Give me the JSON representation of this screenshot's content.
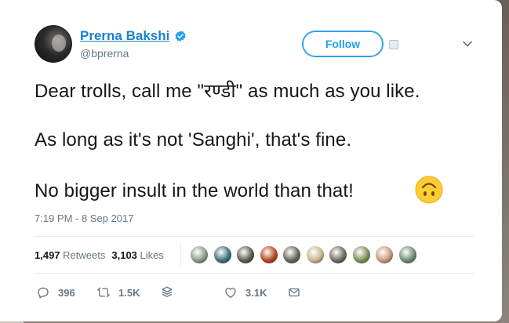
{
  "author": {
    "name": "Prerna Bakshi",
    "handle": "@bprerna",
    "verified": true
  },
  "follow_button": {
    "label": "Follow"
  },
  "tweet": {
    "lines": [
      "Dear trolls, call me \"रण्डी\" as much as you like.",
      "As long as it's not 'Sanghi', that's fine.",
      "No bigger insult in the world than that!"
    ],
    "emoji": "upside-down-face-emoji",
    "timestamp": "7:19 PM - 8 Sep 2017"
  },
  "stats": {
    "retweets_count": "1,497",
    "retweets_label": "Retweets",
    "likes_count": "3,103",
    "likes_label": "Likes"
  },
  "likers": {
    "avatar_colors": [
      "#8a9a8a",
      "#3f6f78",
      "#5c5a48",
      "#b8451f",
      "#5e6a55",
      "#c8b58d",
      "#6f6a5c",
      "#7d8f5a",
      "#c79a7a",
      "#6e8a74"
    ]
  },
  "actions": {
    "reply_count": "396",
    "retweet_count": "1.5K",
    "like_count": "3.1K"
  },
  "colors": {
    "accent": "#1da1f2",
    "name": "#1b7fcc",
    "muted": "#657786",
    "text": "#14171a"
  }
}
